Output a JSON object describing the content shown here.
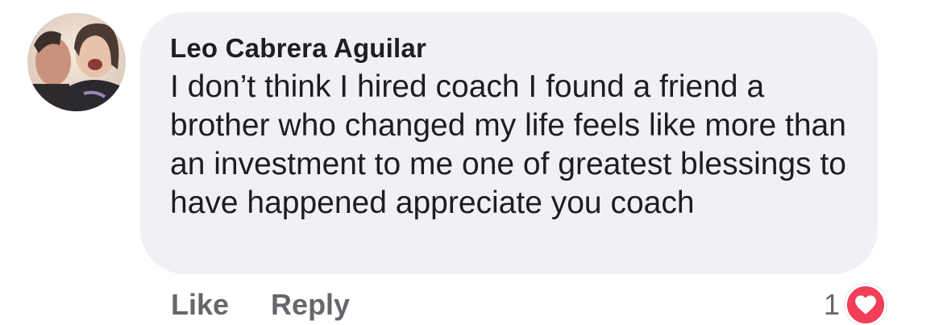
{
  "comment": {
    "author": "Leo Cabrera Aguilar",
    "text": "I don’t think I hired coach I found a friend a brother who changed my life feels like more than an investment to me one of greatest blessings to have happened appreciate you coach"
  },
  "actions": {
    "like_label": "Like",
    "reply_label": "Reply"
  },
  "reactions": {
    "count": "1",
    "icon": "heart-icon",
    "color": "#f33e58"
  },
  "colors": {
    "bubble": "#f0f1f5",
    "text": "#1c1e21",
    "secondary": "#65676b"
  }
}
